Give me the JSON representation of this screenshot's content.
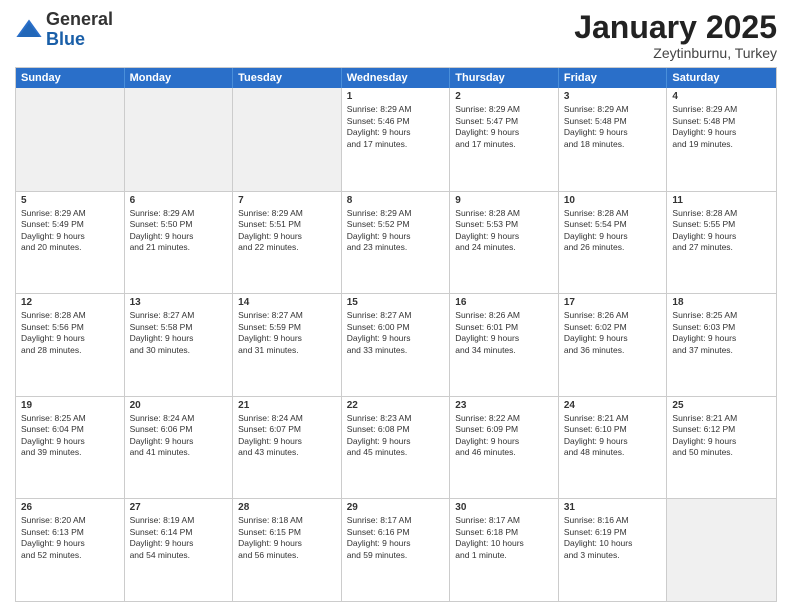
{
  "logo": {
    "general": "General",
    "blue": "Blue"
  },
  "header": {
    "month": "January 2025",
    "location": "Zeytinburnu, Turkey"
  },
  "weekdays": [
    "Sunday",
    "Monday",
    "Tuesday",
    "Wednesday",
    "Thursday",
    "Friday",
    "Saturday"
  ],
  "rows": [
    [
      {
        "day": "",
        "text": ""
      },
      {
        "day": "",
        "text": ""
      },
      {
        "day": "",
        "text": ""
      },
      {
        "day": "1",
        "text": "Sunrise: 8:29 AM\nSunset: 5:46 PM\nDaylight: 9 hours\nand 17 minutes."
      },
      {
        "day": "2",
        "text": "Sunrise: 8:29 AM\nSunset: 5:47 PM\nDaylight: 9 hours\nand 17 minutes."
      },
      {
        "day": "3",
        "text": "Sunrise: 8:29 AM\nSunset: 5:48 PM\nDaylight: 9 hours\nand 18 minutes."
      },
      {
        "day": "4",
        "text": "Sunrise: 8:29 AM\nSunset: 5:48 PM\nDaylight: 9 hours\nand 19 minutes."
      }
    ],
    [
      {
        "day": "5",
        "text": "Sunrise: 8:29 AM\nSunset: 5:49 PM\nDaylight: 9 hours\nand 20 minutes."
      },
      {
        "day": "6",
        "text": "Sunrise: 8:29 AM\nSunset: 5:50 PM\nDaylight: 9 hours\nand 21 minutes."
      },
      {
        "day": "7",
        "text": "Sunrise: 8:29 AM\nSunset: 5:51 PM\nDaylight: 9 hours\nand 22 minutes."
      },
      {
        "day": "8",
        "text": "Sunrise: 8:29 AM\nSunset: 5:52 PM\nDaylight: 9 hours\nand 23 minutes."
      },
      {
        "day": "9",
        "text": "Sunrise: 8:28 AM\nSunset: 5:53 PM\nDaylight: 9 hours\nand 24 minutes."
      },
      {
        "day": "10",
        "text": "Sunrise: 8:28 AM\nSunset: 5:54 PM\nDaylight: 9 hours\nand 26 minutes."
      },
      {
        "day": "11",
        "text": "Sunrise: 8:28 AM\nSunset: 5:55 PM\nDaylight: 9 hours\nand 27 minutes."
      }
    ],
    [
      {
        "day": "12",
        "text": "Sunrise: 8:28 AM\nSunset: 5:56 PM\nDaylight: 9 hours\nand 28 minutes."
      },
      {
        "day": "13",
        "text": "Sunrise: 8:27 AM\nSunset: 5:58 PM\nDaylight: 9 hours\nand 30 minutes."
      },
      {
        "day": "14",
        "text": "Sunrise: 8:27 AM\nSunset: 5:59 PM\nDaylight: 9 hours\nand 31 minutes."
      },
      {
        "day": "15",
        "text": "Sunrise: 8:27 AM\nSunset: 6:00 PM\nDaylight: 9 hours\nand 33 minutes."
      },
      {
        "day": "16",
        "text": "Sunrise: 8:26 AM\nSunset: 6:01 PM\nDaylight: 9 hours\nand 34 minutes."
      },
      {
        "day": "17",
        "text": "Sunrise: 8:26 AM\nSunset: 6:02 PM\nDaylight: 9 hours\nand 36 minutes."
      },
      {
        "day": "18",
        "text": "Sunrise: 8:25 AM\nSunset: 6:03 PM\nDaylight: 9 hours\nand 37 minutes."
      }
    ],
    [
      {
        "day": "19",
        "text": "Sunrise: 8:25 AM\nSunset: 6:04 PM\nDaylight: 9 hours\nand 39 minutes."
      },
      {
        "day": "20",
        "text": "Sunrise: 8:24 AM\nSunset: 6:06 PM\nDaylight: 9 hours\nand 41 minutes."
      },
      {
        "day": "21",
        "text": "Sunrise: 8:24 AM\nSunset: 6:07 PM\nDaylight: 9 hours\nand 43 minutes."
      },
      {
        "day": "22",
        "text": "Sunrise: 8:23 AM\nSunset: 6:08 PM\nDaylight: 9 hours\nand 45 minutes."
      },
      {
        "day": "23",
        "text": "Sunrise: 8:22 AM\nSunset: 6:09 PM\nDaylight: 9 hours\nand 46 minutes."
      },
      {
        "day": "24",
        "text": "Sunrise: 8:21 AM\nSunset: 6:10 PM\nDaylight: 9 hours\nand 48 minutes."
      },
      {
        "day": "25",
        "text": "Sunrise: 8:21 AM\nSunset: 6:12 PM\nDaylight: 9 hours\nand 50 minutes."
      }
    ],
    [
      {
        "day": "26",
        "text": "Sunrise: 8:20 AM\nSunset: 6:13 PM\nDaylight: 9 hours\nand 52 minutes."
      },
      {
        "day": "27",
        "text": "Sunrise: 8:19 AM\nSunset: 6:14 PM\nDaylight: 9 hours\nand 54 minutes."
      },
      {
        "day": "28",
        "text": "Sunrise: 8:18 AM\nSunset: 6:15 PM\nDaylight: 9 hours\nand 56 minutes."
      },
      {
        "day": "29",
        "text": "Sunrise: 8:17 AM\nSunset: 6:16 PM\nDaylight: 9 hours\nand 59 minutes."
      },
      {
        "day": "30",
        "text": "Sunrise: 8:17 AM\nSunset: 6:18 PM\nDaylight: 10 hours\nand 1 minute."
      },
      {
        "day": "31",
        "text": "Sunrise: 8:16 AM\nSunset: 6:19 PM\nDaylight: 10 hours\nand 3 minutes."
      },
      {
        "day": "",
        "text": ""
      }
    ]
  ]
}
